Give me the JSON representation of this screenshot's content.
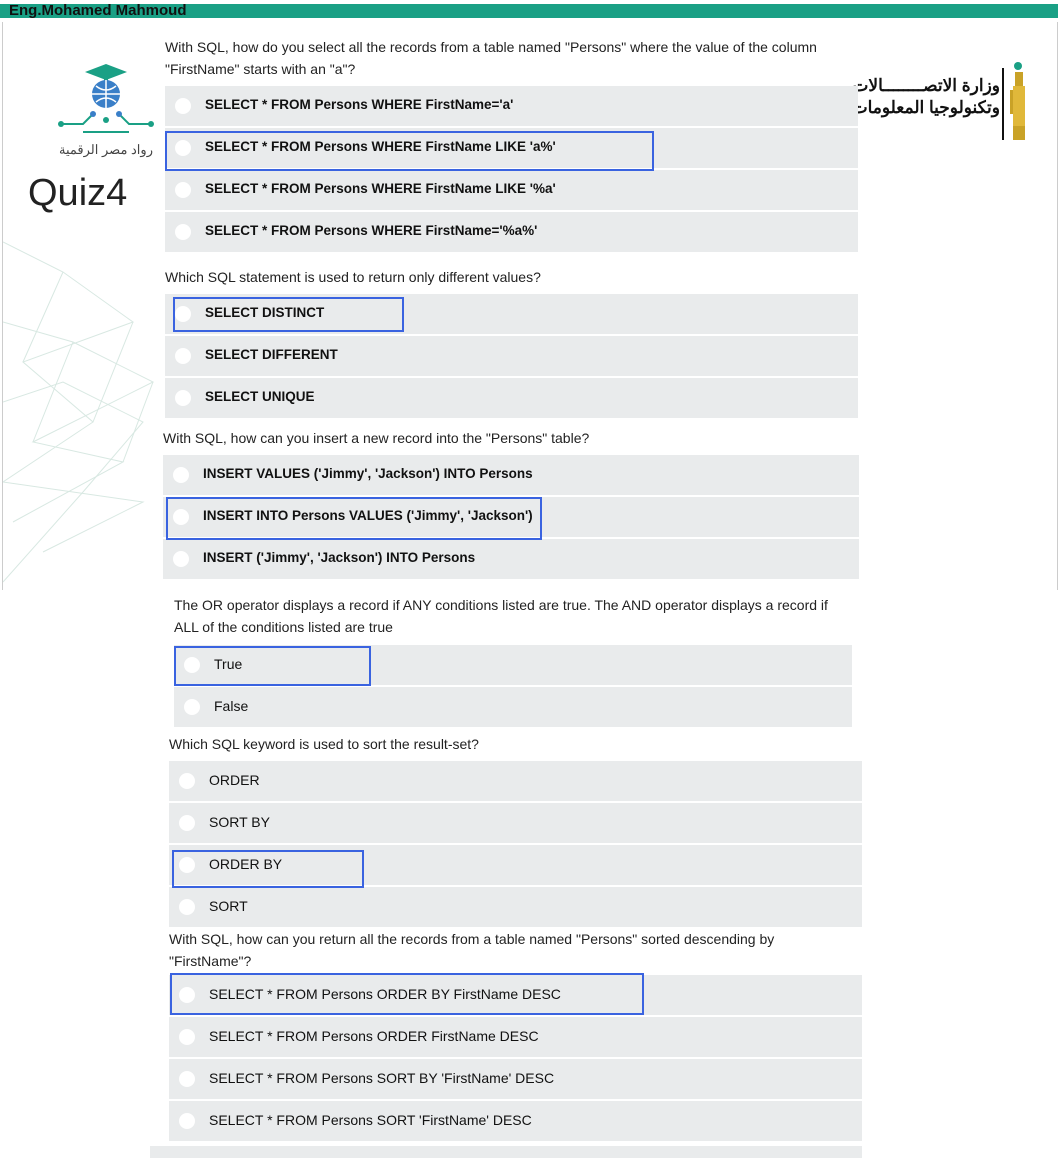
{
  "author": "Eng.Mohamed Mahmoud",
  "quiz_title": "Quiz4",
  "logos": {
    "rowad_caption": "رواد مصر الرقمية",
    "mcit_line1": "وزارة الاتصــــــــالات",
    "mcit_line2": "وتكنولوجيا المعلومات"
  },
  "colors": {
    "brand_green": "#1aa085",
    "answer_highlight": "#3a63e0",
    "option_bg": "#e9ebec"
  },
  "questions": [
    {
      "text_line1": "With SQL, how do you select all the records from a table named \"Persons\" where the value of the column",
      "text_line2": "\"FirstName\" starts with an \"a\"?",
      "options": [
        "SELECT * FROM Persons WHERE FirstName='a'",
        "SELECT * FROM Persons WHERE FirstName LIKE 'a%'",
        "SELECT * FROM Persons WHERE FirstName LIKE '%a'",
        "SELECT * FROM Persons WHERE FirstName='%a%'"
      ],
      "highlighted_index": 1
    },
    {
      "text_line1": "Which SQL statement is used to return only different values?",
      "options": [
        "SELECT DISTINCT",
        "SELECT DIFFERENT",
        "SELECT UNIQUE"
      ],
      "highlighted_index": 0
    },
    {
      "text_line1": "With SQL, how can you insert a new record into the \"Persons\" table?",
      "options": [
        "INSERT VALUES ('Jimmy', 'Jackson') INTO Persons",
        "INSERT INTO Persons VALUES ('Jimmy', 'Jackson')",
        "INSERT ('Jimmy', 'Jackson') INTO Persons"
      ],
      "highlighted_index": 1
    },
    {
      "text_line1": "The OR operator displays a record if ANY conditions listed are true. The AND operator displays a record if",
      "text_line2": "ALL of the conditions listed are true",
      "options": [
        "True",
        "False"
      ],
      "highlighted_index": 0
    },
    {
      "text_line1": "Which SQL keyword is used to sort the result-set?",
      "options": [
        "ORDER",
        "SORT BY",
        "ORDER BY",
        "SORT"
      ],
      "highlighted_index": 2
    },
    {
      "text_line1": "With SQL, how can you return all the records from a table named \"Persons\" sorted descending by",
      "text_line2": "\"FirstName\"?",
      "options": [
        "SELECT * FROM Persons ORDER BY FirstName DESC",
        "SELECT * FROM Persons ORDER FirstName DESC",
        "SELECT * FROM Persons SORT BY 'FirstName' DESC",
        "SELECT * FROM Persons SORT 'FirstName' DESC"
      ],
      "highlighted_index": 0
    }
  ]
}
